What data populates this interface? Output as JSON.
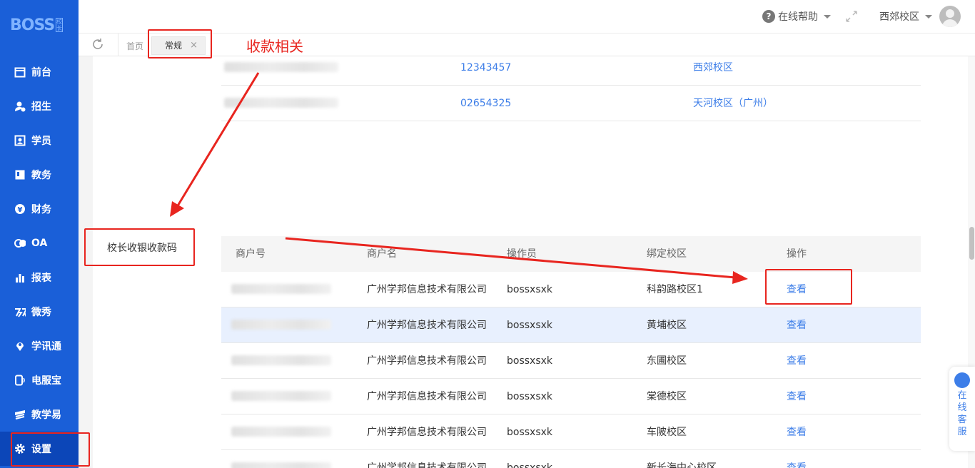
{
  "app": {
    "logo": "BOSS",
    "logo_sub": "校长"
  },
  "sidebar": {
    "items": [
      {
        "label": "前台",
        "icon": "calendar-icon"
      },
      {
        "label": "招生",
        "icon": "add-user-icon"
      },
      {
        "label": "学员",
        "icon": "student-card-icon"
      },
      {
        "label": "教务",
        "icon": "book-icon"
      },
      {
        "label": "财务",
        "icon": "yuan-icon"
      },
      {
        "label": "OA",
        "icon": "oa-icon"
      },
      {
        "label": "报表",
        "icon": "bar-chart-icon"
      },
      {
        "label": "微秀",
        "icon": "wechat-show-icon"
      },
      {
        "label": "学讯通",
        "icon": "location-pin-icon"
      },
      {
        "label": "电服宝",
        "icon": "phone-service-icon"
      },
      {
        "label": "教学易",
        "icon": "teaching-icon"
      },
      {
        "label": "设置",
        "icon": "gear-icon"
      }
    ]
  },
  "header": {
    "help_label": "在线帮助",
    "campus": "西郊校区"
  },
  "tabs": {
    "home": "首页",
    "active": "常规",
    "close": "×"
  },
  "annotation": {
    "label": "收款相关"
  },
  "section_label": "校长收银收款码",
  "top_rows": [
    {
      "code": "12343457",
      "campus": "西郊校区"
    },
    {
      "code": "02654325",
      "campus": "天河校区（广州）"
    }
  ],
  "table": {
    "headers": [
      "商户号",
      "商户名",
      "操作员",
      "绑定校区",
      "操作"
    ],
    "rows": [
      {
        "merchant_name": "广州学邦信息技术有限公司",
        "operator": "bossxsxk",
        "campus": "科韵路校区1",
        "action": "查看"
      },
      {
        "merchant_name": "广州学邦信息技术有限公司",
        "operator": "bossxsxk",
        "campus": "黄埔校区",
        "action": "查看"
      },
      {
        "merchant_name": "广州学邦信息技术有限公司",
        "operator": "bossxsxk",
        "campus": "东圃校区",
        "action": "查看"
      },
      {
        "merchant_name": "广州学邦信息技术有限公司",
        "operator": "bossxsxk",
        "campus": "棠德校区",
        "action": "查看"
      },
      {
        "merchant_name": "广州学邦信息技术有限公司",
        "operator": "bossxsxk",
        "campus": "车陂校区",
        "action": "查看"
      },
      {
        "merchant_name": "广州学邦信息技术有限公司",
        "operator": "bossxsxk",
        "campus": "新长海中心校区",
        "action": "查看"
      }
    ]
  },
  "support": {
    "label": "在线客服"
  },
  "colors": {
    "sidebar": "#1a5fd8",
    "link": "#3d7ee8",
    "annotation": "#e8251f"
  }
}
